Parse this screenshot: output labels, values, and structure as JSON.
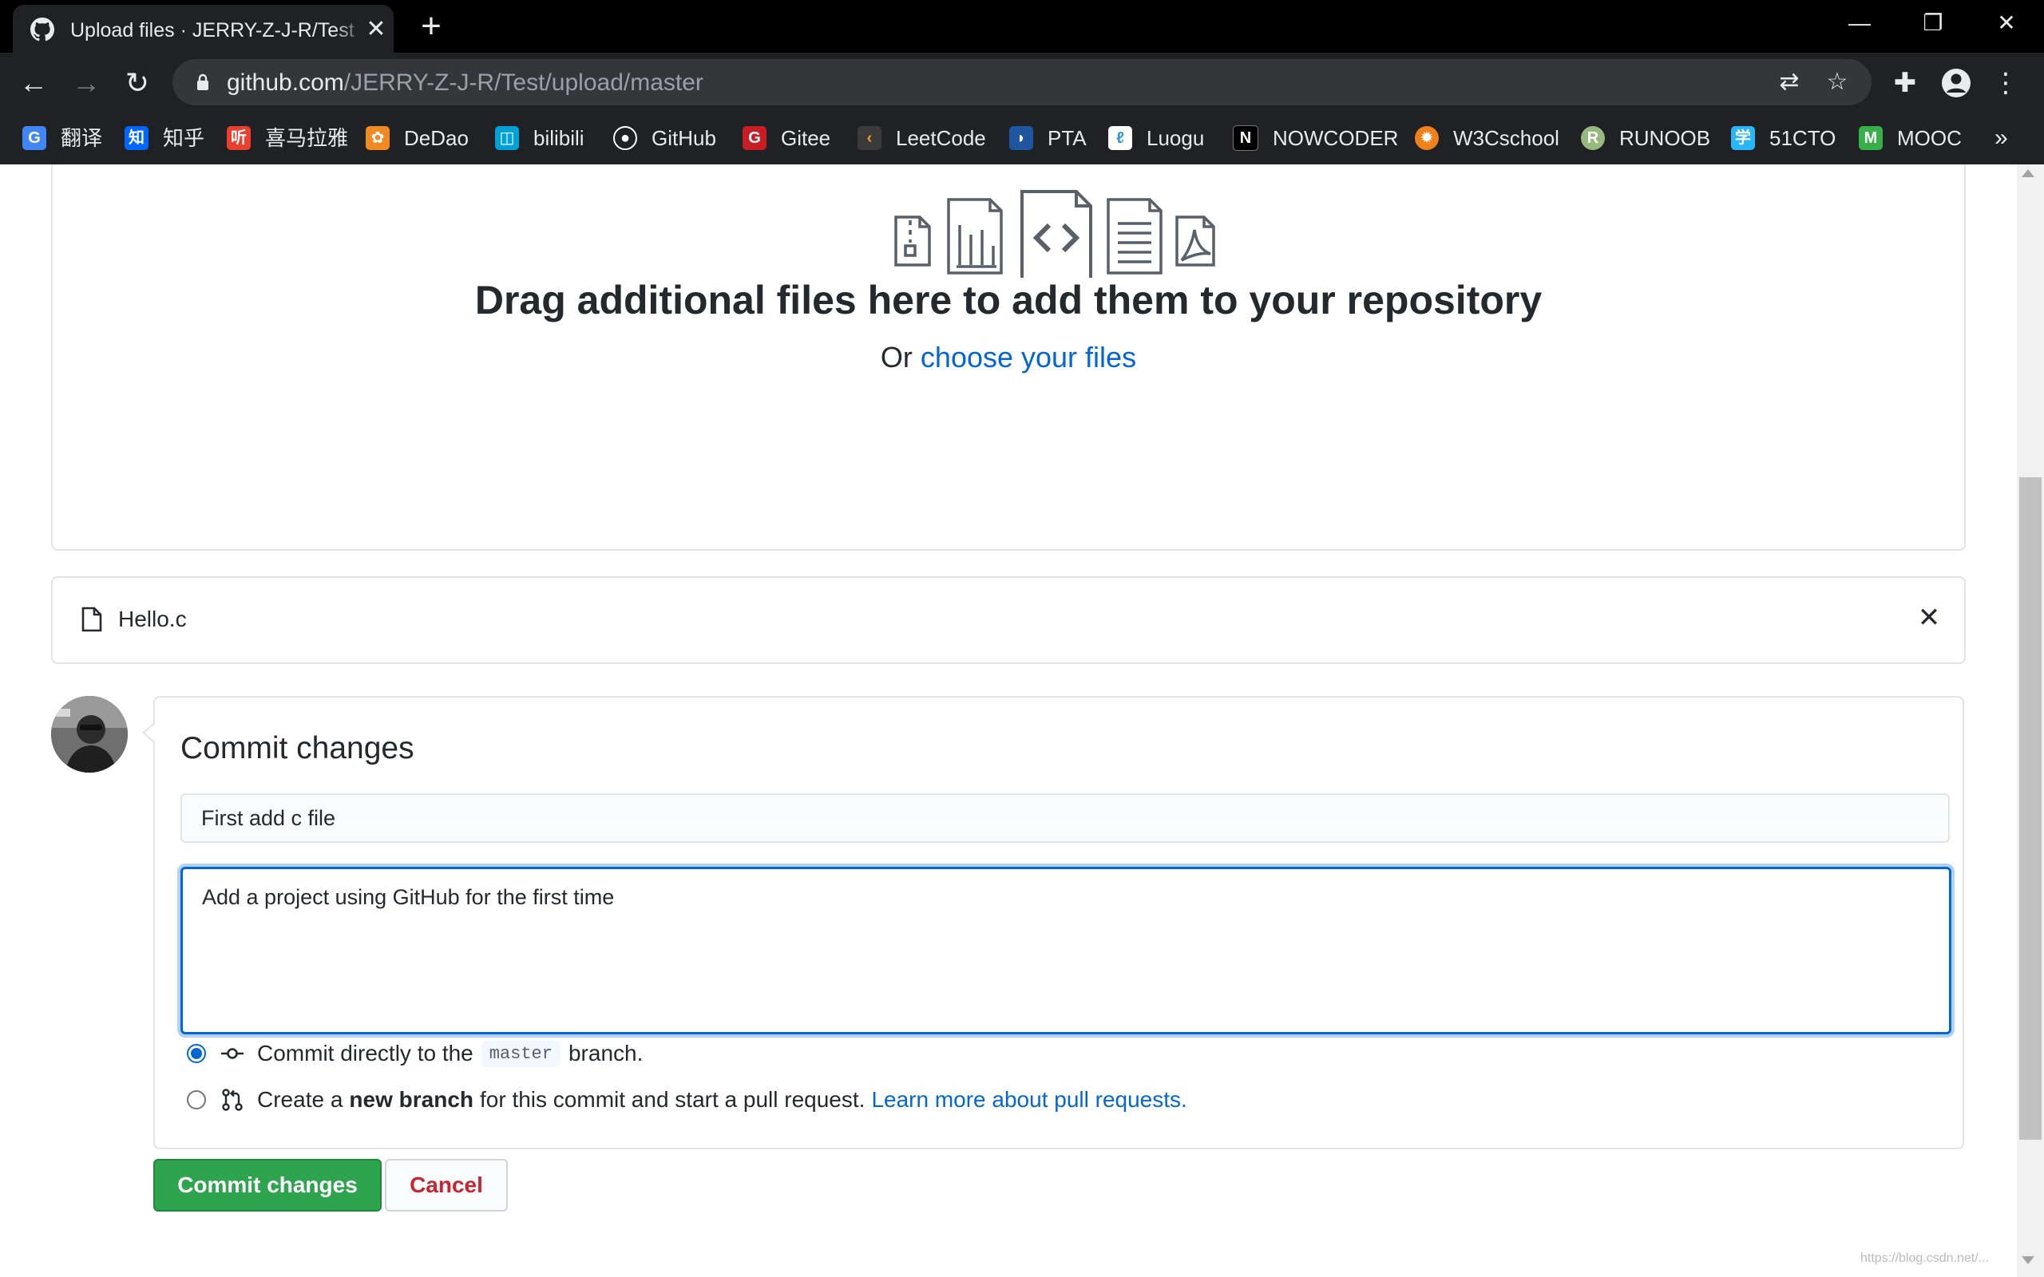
{
  "browser": {
    "tab_title": "Upload files · JERRY-Z-J-R/Test",
    "tab_close": "✕",
    "new_tab": "+",
    "url_host": "github.com",
    "url_path": "/JERRY-Z-J-R/Test/upload/master",
    "window_buttons": [
      "—",
      "❐",
      "✕"
    ],
    "bookmarks_more": "»",
    "bookmarks": [
      {
        "label": "翻译",
        "icon": "google-translate-icon",
        "color": "#4285f4",
        "glyph": "G"
      },
      {
        "label": "知乎",
        "icon": "zhihu-icon",
        "color": "#0066ff",
        "glyph": "知"
      },
      {
        "label": "喜马拉雅",
        "icon": "ximalaya-icon",
        "color": "#e83f2e",
        "glyph": "听"
      },
      {
        "label": "DeDao",
        "icon": "dedao-icon",
        "color": "#f08a24",
        "glyph": "✿"
      },
      {
        "label": "bilibili",
        "icon": "bilibili-icon",
        "color": "#00a1d6",
        "glyph": "◫"
      },
      {
        "label": "GitHub",
        "icon": "github-icon",
        "color": "#ffffff",
        "glyph": "●"
      },
      {
        "label": "Gitee",
        "icon": "gitee-icon",
        "color": "#c71d23",
        "glyph": "G"
      },
      {
        "label": "LeetCode",
        "icon": "leetcode-icon",
        "color": "#f89f1b",
        "glyph": "‹"
      },
      {
        "label": "PTA",
        "icon": "pta-icon",
        "color": "#1e56a0",
        "glyph": "◗"
      },
      {
        "label": "Luogu",
        "icon": "luogu-icon",
        "color": "#3498db",
        "glyph": "ℓ"
      },
      {
        "label": "NOWCODER",
        "icon": "nowcoder-icon",
        "color": "#222222",
        "glyph": "N"
      },
      {
        "label": "W3Cschool",
        "icon": "w3cschool-icon",
        "color": "#f0801a",
        "glyph": "✹"
      },
      {
        "label": "RUNOOB",
        "icon": "runoob-icon",
        "color": "#96b97d",
        "glyph": "R"
      },
      {
        "label": "51CTO",
        "icon": "51cto-icon",
        "color": "#29b6f6",
        "glyph": "学"
      },
      {
        "label": "MOOC",
        "icon": "mooc-icon",
        "color": "#38b04a",
        "glyph": "M"
      }
    ]
  },
  "upload": {
    "drag_title": "Drag additional files here to add them to your repository",
    "or_text": "Or ",
    "choose_link": "choose your files",
    "file_name": "Hello.c",
    "file_remove": "✕"
  },
  "commit": {
    "title": "Commit changes",
    "summary_value": "First add c file",
    "description_value": "Add a project using GitHub for the first time",
    "option_direct_prefix": "Commit directly to the",
    "option_direct_branch": "master",
    "option_direct_suffix": "branch.",
    "option_new_prefix": "Create a",
    "option_new_bold": "new branch",
    "option_new_suffix": "for this commit and start a pull request.",
    "option_new_link": "Learn more about pull requests.",
    "commit_button": "Commit changes",
    "cancel_button": "Cancel"
  },
  "watermark": "https://blog.csdn.net/...",
  "colors": {
    "accent_blue": "#0366d6",
    "commit_green": "#2ea44f",
    "cancel_red": "#cb2431",
    "chrome_dark": "#202124"
  }
}
